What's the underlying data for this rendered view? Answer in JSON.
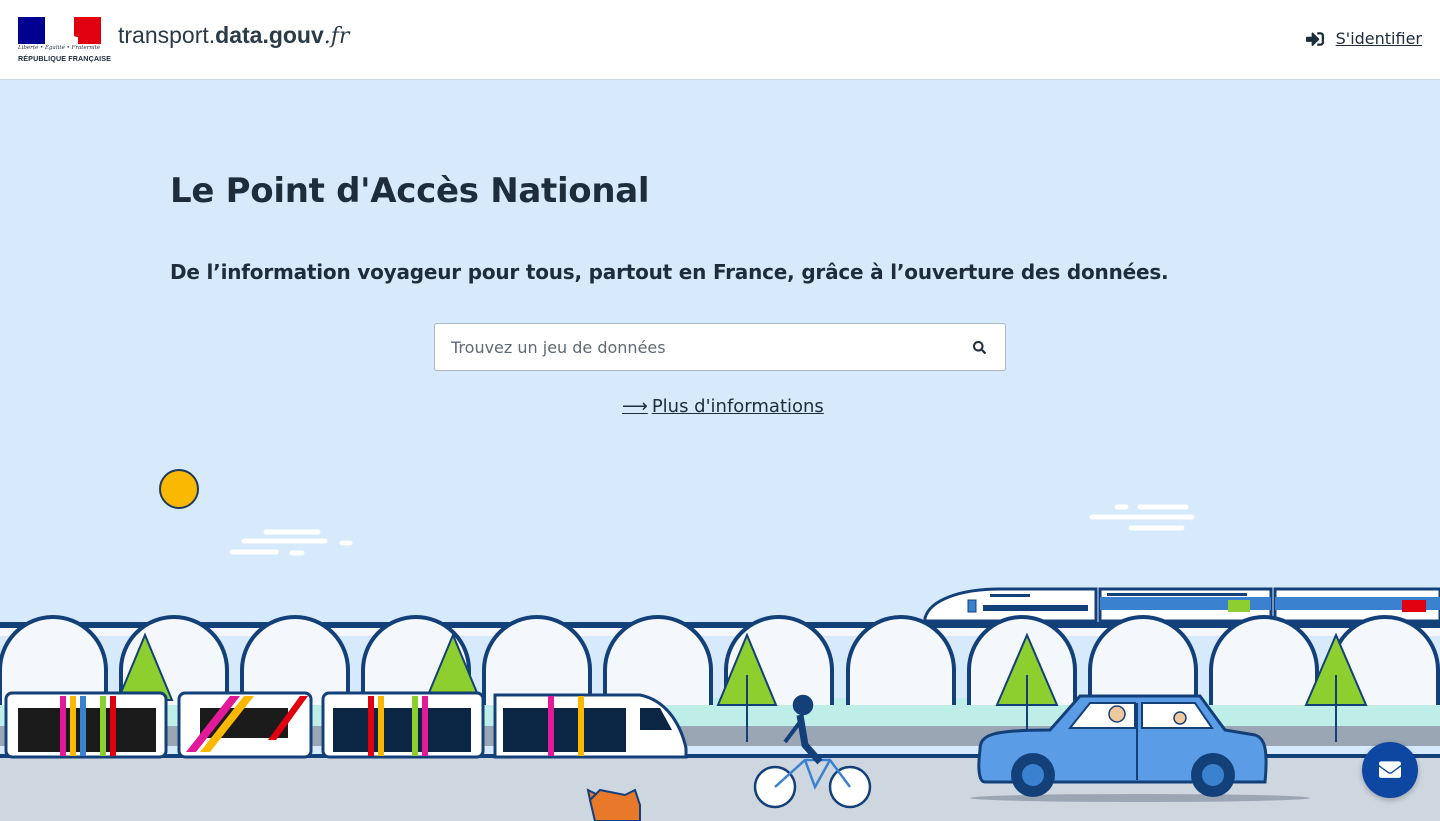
{
  "header": {
    "marianne_motto": "Liberté • Égalité • Fraternité",
    "marianne_name": "RÉPUBLIQUE FRANÇAISE",
    "site_name_part1": "transport.",
    "site_name_part2": "data.gouv",
    "site_name_part3": ".fr",
    "login_label": "S'identifier"
  },
  "hero": {
    "title": "Le Point d'Accès National",
    "subtitle": "De l’information voyageur pour tous, partout en France, grâce à l’ouverture des données.",
    "search_placeholder": "Trouvez un jeu de données",
    "more_info_arrow": "⟶",
    "more_info_label": "Plus d'informations"
  },
  "colors": {
    "sky": "#d6eafc",
    "sun": "#fbb800",
    "navy": "#0d47a1",
    "tree": "#8ccf2e",
    "car": "#5a9de6"
  },
  "icons": {
    "login": "sign-in-icon",
    "search": "search-icon",
    "contact": "envelope-icon",
    "more_info": "arrow-right-icon"
  }
}
